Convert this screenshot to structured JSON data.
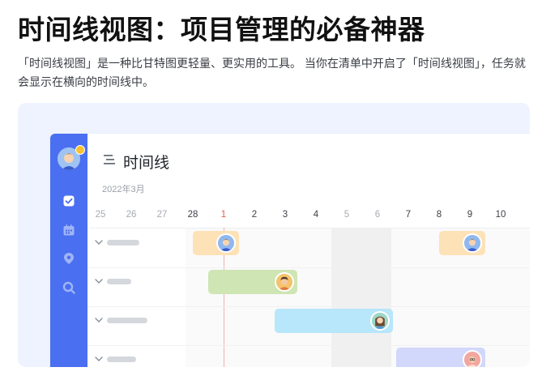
{
  "article": {
    "title": "时间线视图：项目管理的必备神器",
    "intro": "「时间线视图」是一种比甘特图更轻量、更实用的工具。 当你在清单中开启了「时间线视图」，任务就会显示在横向的时间线中。"
  },
  "app": {
    "title": "时间线",
    "month": "2022年3月",
    "days": [
      {
        "label": "25",
        "style": "dim"
      },
      {
        "label": "26",
        "style": "dim"
      },
      {
        "label": "27",
        "style": "dim"
      },
      {
        "label": "28",
        "style": "normal"
      },
      {
        "label": "1",
        "style": "today"
      },
      {
        "label": "2",
        "style": "normal"
      },
      {
        "label": "3",
        "style": "normal"
      },
      {
        "label": "4",
        "style": "normal"
      },
      {
        "label": "5",
        "style": "dim"
      },
      {
        "label": "6",
        "style": "dim"
      },
      {
        "label": "7",
        "style": "normal"
      },
      {
        "label": "8",
        "style": "normal"
      },
      {
        "label": "9",
        "style": "normal"
      },
      {
        "label": "10",
        "style": "normal"
      }
    ],
    "sidebar_icons": [
      "checkbox-icon",
      "calendar-icon",
      "location-pin-icon",
      "search-icon"
    ],
    "tasks": [
      {
        "start": 28,
        "end": 1.5,
        "color": "#fde2b8",
        "avatar": "male-short-hair"
      },
      {
        "start": 8,
        "end": 9.5,
        "color": "#fde2b8",
        "avatar": "male-short-hair"
      },
      {
        "start": 0.5,
        "end": 3.4,
        "color": "#cfe5b4",
        "avatar": "male-curly-hair"
      },
      {
        "start": 2.65,
        "end": 6.5,
        "color": "#b8e6fb",
        "avatar": "female-long-hair"
      },
      {
        "start": 6.6,
        "end": 9.5,
        "color": "#d2d8fb",
        "avatar": "male-glasses"
      }
    ],
    "colors": {
      "sidebar": "#4a6ff0",
      "today": "#e05a4f"
    }
  }
}
